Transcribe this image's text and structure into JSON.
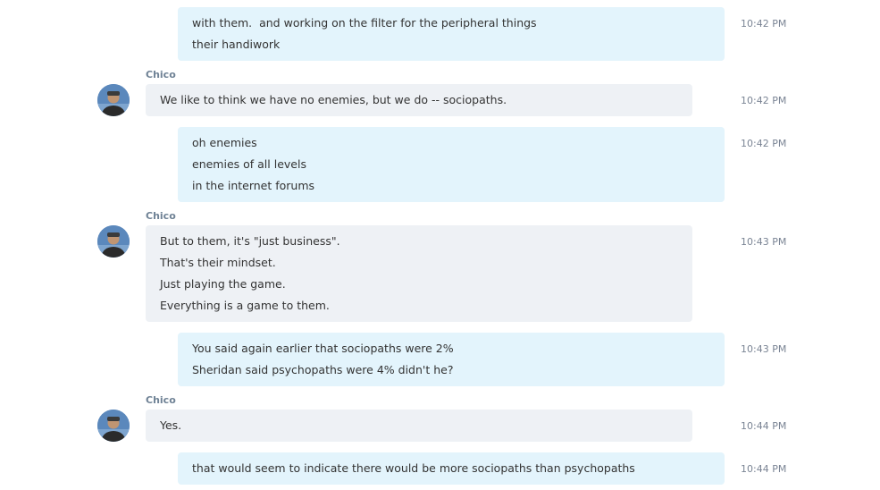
{
  "contact_name": "Chico",
  "messages": [
    {
      "direction": "out",
      "lines": [
        "with them.  and working on the filter for the peripheral things",
        "their handiwork"
      ],
      "time": "10:42 PM"
    },
    {
      "direction": "in",
      "sender": "Chico",
      "lines": [
        "We like to think we have no enemies, but we do -- sociopaths."
      ],
      "time": "10:42 PM"
    },
    {
      "direction": "out",
      "lines": [
        "oh enemies",
        "enemies of all levels",
        "in the internet forums"
      ],
      "time": "10:42 PM"
    },
    {
      "direction": "in",
      "sender": "Chico",
      "lines": [
        "But to them, it's \"just business\".",
        "That's their mindset.",
        "Just playing the game.",
        "Everything is a game to them."
      ],
      "time": "10:43 PM"
    },
    {
      "direction": "out",
      "lines": [
        "You said again earlier that sociopaths were 2%",
        "Sheridan said psychopaths were 4% didn't he?"
      ],
      "time": "10:43 PM"
    },
    {
      "direction": "in",
      "sender": "Chico",
      "lines": [
        "Yes."
      ],
      "time": "10:44 PM"
    },
    {
      "direction": "out",
      "lines": [
        "that would seem to indicate there would be more sociopaths than psychopaths"
      ],
      "time": "10:44 PM"
    }
  ],
  "colors": {
    "outgoing_bubble": "#e3f4fc",
    "incoming_bubble": "#eef1f5",
    "sender_name": "#6f8295",
    "timestamp": "#7a8494",
    "text": "#333333"
  },
  "icons": {
    "avatar": "contact-avatar-photo"
  }
}
